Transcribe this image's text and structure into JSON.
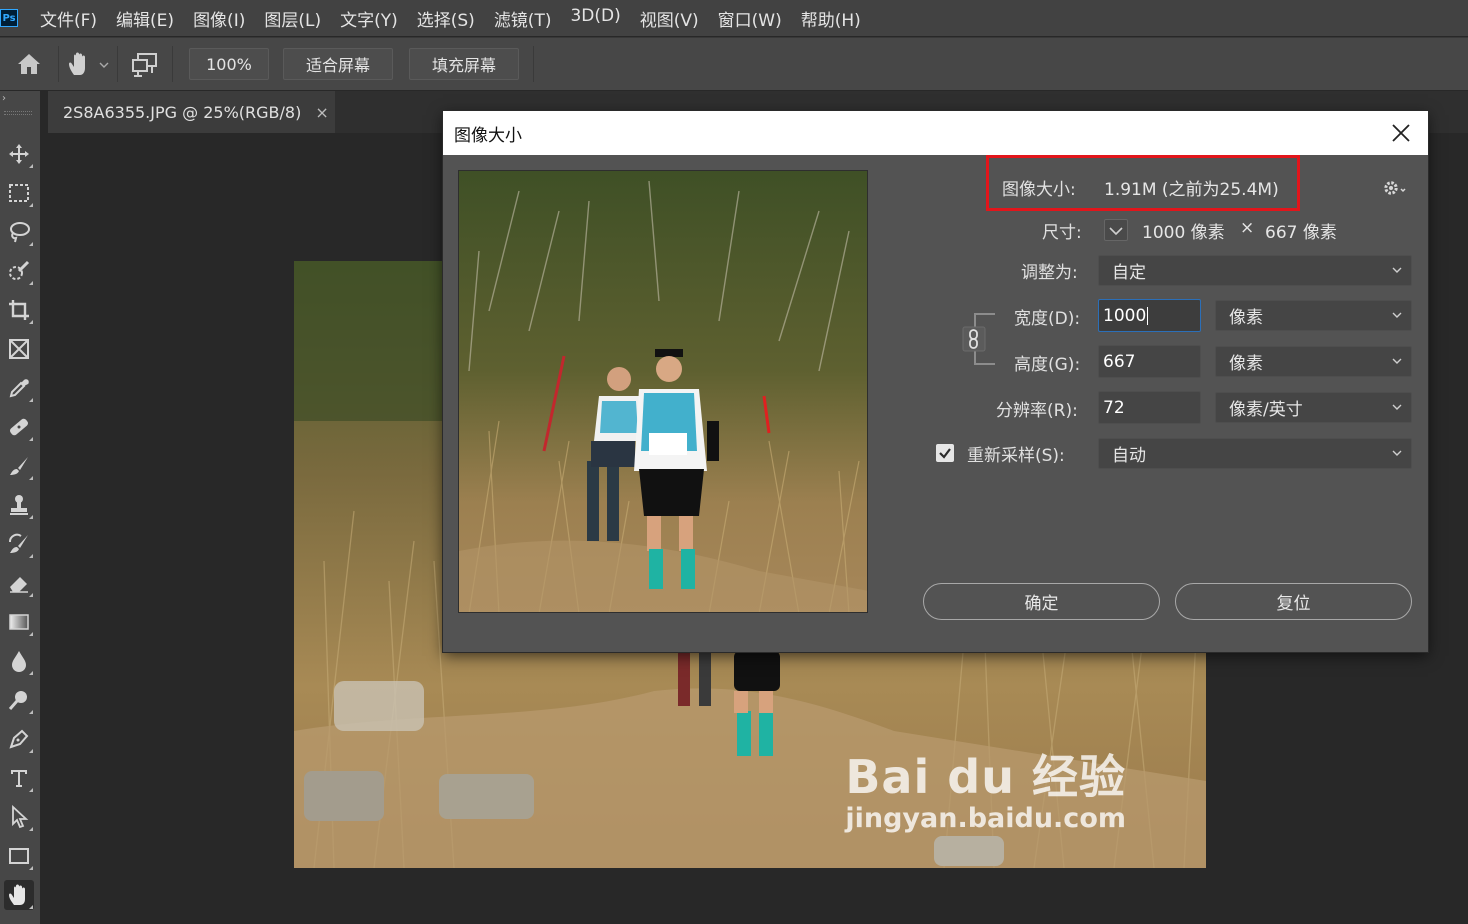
{
  "app": {
    "logo": "Ps"
  },
  "menu": [
    "文件(F)",
    "编辑(E)",
    "图像(I)",
    "图层(L)",
    "文字(Y)",
    "选择(S)",
    "滤镜(T)",
    "3D(D)",
    "视图(V)",
    "窗口(W)",
    "帮助(H)"
  ],
  "options_bar": {
    "zoom_label": "100%",
    "fit_screen_label": "适合屏幕",
    "fill_screen_label": "填充屏幕"
  },
  "document_tab": {
    "title": "2S8A6355.JPG @ 25%(RGB/8)",
    "close_glyph": "×"
  },
  "dialog": {
    "title": "图像大小",
    "image_size_label": "图像大小:",
    "image_size_value": "1.91M (之前为25.4M)",
    "dimensions_label": "尺寸:",
    "dim_width": "1000 像素",
    "dim_times": "×",
    "dim_height": "667 像素",
    "fit_to_label": "调整为:",
    "fit_to_value": "自定",
    "width_label": "宽度(D):",
    "width_value": "1000",
    "width_unit": "像素",
    "height_label": "高度(G):",
    "height_value": "667",
    "height_unit": "像素",
    "resolution_label": "分辨率(R):",
    "resolution_value": "72",
    "resolution_unit": "像素/英寸",
    "resample_label": "重新采样(S):",
    "resample_checked": true,
    "resample_value": "自动",
    "ok_label": "确定",
    "reset_label": "复位"
  },
  "watermark": {
    "brand": "Bai du 经验",
    "url": "jingyan.baidu.com"
  },
  "colors": {
    "highlight": "#e2151b",
    "focus": "#2b6fb8",
    "ps_blue": "#31a8ff"
  }
}
